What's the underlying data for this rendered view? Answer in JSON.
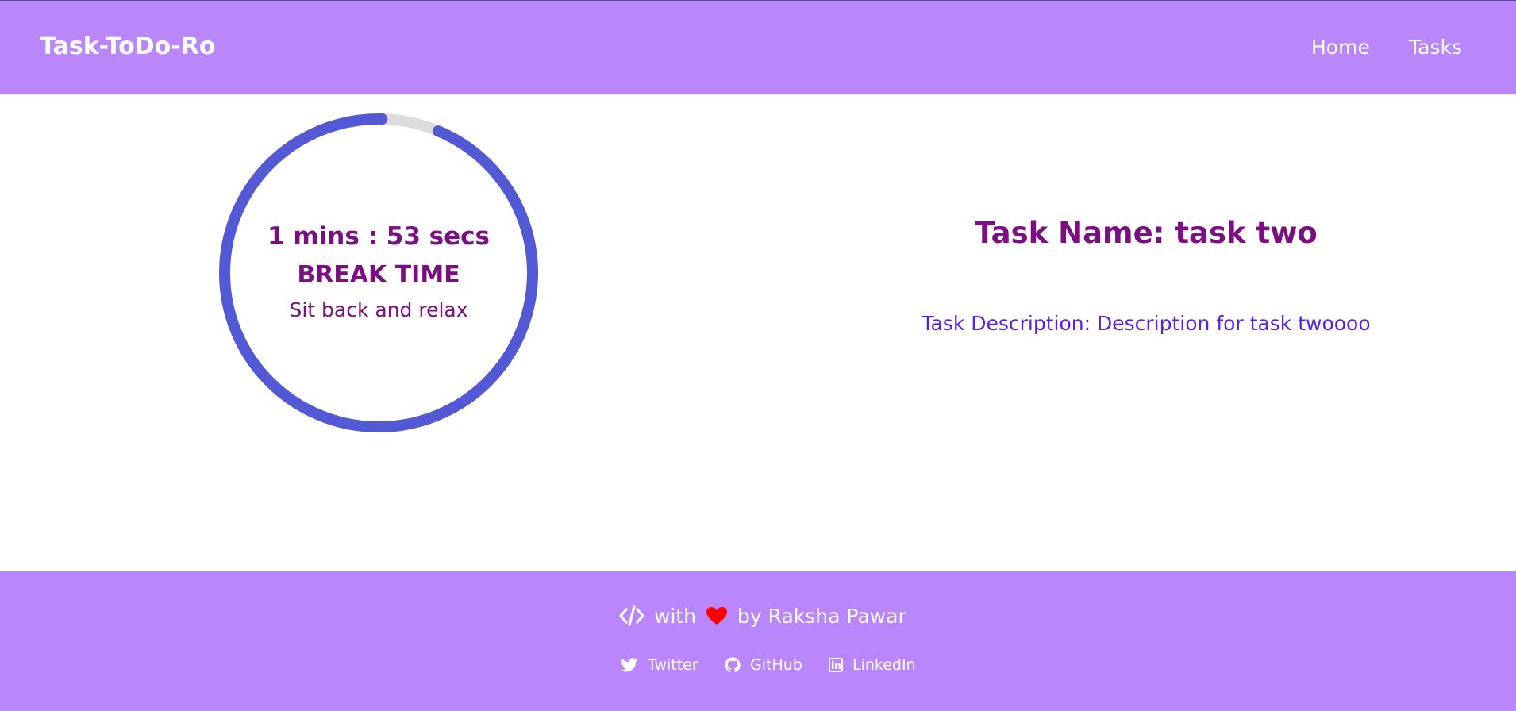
{
  "app": {
    "brand": "Task-ToDo-Ro"
  },
  "nav": {
    "items": [
      {
        "label": "Home"
      },
      {
        "label": "Tasks"
      }
    ]
  },
  "timer": {
    "time_display": "1 mins : 53 secs",
    "mode_label": "BREAK TIME",
    "message": "Sit back and relax",
    "progress_fraction": 0.94
  },
  "task": {
    "name_line": "Task Name: task two",
    "description_line": "Task Description: Description for task twoooo"
  },
  "footer": {
    "credit_with": "with",
    "credit_by": "by Raksha Pawar",
    "icons": {
      "code": "code-icon",
      "heart": "heart-icon"
    },
    "links": [
      {
        "label": "Twitter",
        "icon": "twitter-icon"
      },
      {
        "label": "GitHub",
        "icon": "github-icon"
      },
      {
        "label": "LinkedIn",
        "icon": "linkedin-icon"
      }
    ]
  },
  "colors": {
    "header_footer_bg": "#b986fc",
    "progress_ring": "#5359d4",
    "ring_track": "#dcdcdc",
    "title_text": "#7b0f82",
    "description_text": "#5a1ee8",
    "heart": "#ff0000"
  }
}
